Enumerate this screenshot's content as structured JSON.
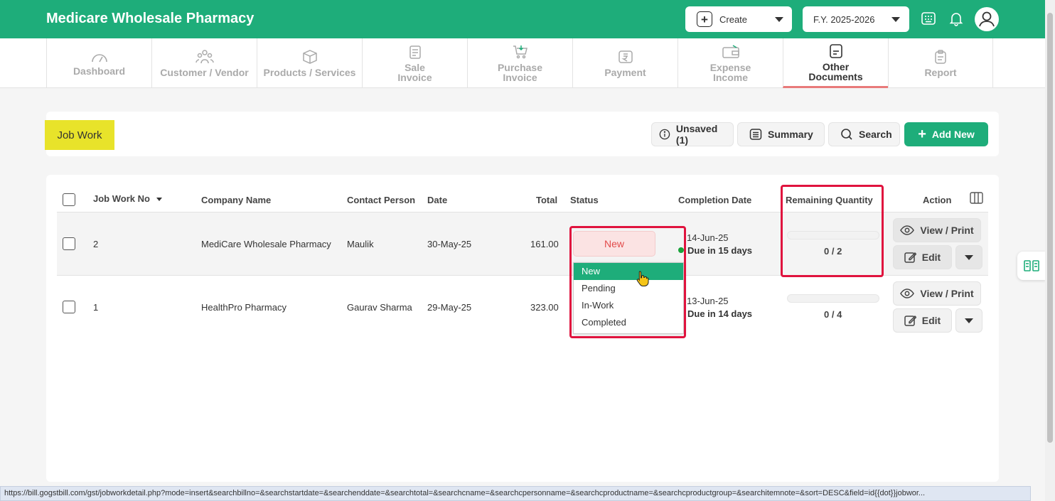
{
  "header": {
    "brand": "Medicare Wholesale Pharmacy",
    "create_label": "Create",
    "fy_label": "F.Y. 2025-2026"
  },
  "nav": {
    "tabs": [
      {
        "label": "Dashboard",
        "icon": "gauge-icon"
      },
      {
        "label": "Customer / Vendor",
        "icon": "users-icon"
      },
      {
        "label": "Products / Services",
        "icon": "box-icon"
      },
      {
        "label": "Sale\nInvoice",
        "icon": "invoice-icon"
      },
      {
        "label": "Purchase\nInvoice",
        "icon": "cart-icon"
      },
      {
        "label": "Payment",
        "icon": "rupee-icon"
      },
      {
        "label": "Expense\nIncome",
        "icon": "wallet-icon"
      },
      {
        "label": "Other\nDocuments",
        "icon": "document-icon"
      },
      {
        "label": "Report",
        "icon": "clipboard-icon"
      }
    ]
  },
  "toolbar": {
    "page_tag": "Job Work",
    "unsaved_label": "Unsaved (1)",
    "summary_label": "Summary",
    "search_label": "Search",
    "addnew_label": "Add New"
  },
  "table": {
    "columns": {
      "job_no": "Job Work No",
      "company": "Company Name",
      "contact": "Contact Person",
      "date": "Date",
      "total": "Total",
      "status": "Status",
      "completion": "Completion Date",
      "remaining": "Remaining Quantity",
      "action": "Action"
    },
    "rows": [
      {
        "job_no": "2",
        "company": "MediCare Wholesale Pharmacy",
        "contact": "Maulik",
        "date": "30-May-25",
        "total": "161.00",
        "status": "New",
        "completion_date": "14-Jun-25",
        "due": "Due in 15 days",
        "remaining": "0 / 2"
      },
      {
        "job_no": "1",
        "company": "HealthPro Pharmacy",
        "contact": "Gaurav Sharma",
        "date": "29-May-25",
        "total": "323.00",
        "status": "",
        "completion_date": "13-Jun-25",
        "due": "Due in 14 days",
        "remaining": "0 / 4"
      }
    ],
    "view_label": "View / Print",
    "edit_label": "Edit"
  },
  "status_dropdown": {
    "options": [
      "New",
      "Pending",
      "In-Work",
      "Completed"
    ],
    "selected": "New"
  },
  "status_url": "https://bill.gogstbill.com/gst/jobworkdetail.php?mode=insert&searchbillno=&searchstartdate=&searchenddate=&searchtotal=&searchcname=&searchcpersonname=&searchcproductname=&searchcproductgroup=&searchitemnote=&sort=DESC&field=id{{dot}}jobwor...",
  "colors": {
    "brand_green": "#1ead7a",
    "highlight_red": "#e0133e",
    "tag_yellow": "#e8e32a"
  }
}
